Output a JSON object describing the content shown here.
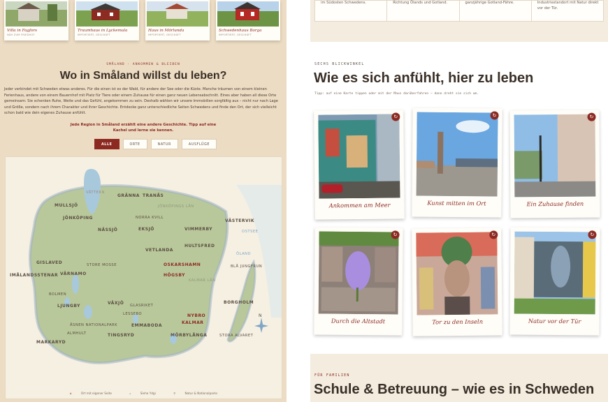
{
  "house_cards": [
    {
      "title": "Villa in Fagfors",
      "sub": "NÄH ZUM FRIEDHOF"
    },
    {
      "title": "Traumhaus in Lyckemala",
      "sub": "IMPORTIERT, GESCHÄFT"
    },
    {
      "title": "Haus in Mörlunda",
      "sub": "IMPORTIERT, GESCHÄFT"
    },
    {
      "title": "Schwedenhaus Borga",
      "sub": "IMPORTIERT, GESCHÄFT"
    }
  ],
  "region": {
    "kicker": "SMÅLAND · ANKOMMEN & BLEIBEN",
    "title": "Wo in Småland willst du leben?",
    "intro": "Jeder verbindet mit Schweden etwas anderes. Für die einen ist es der Wald, für andere der See oder die Küste. Manche träumen von einem kleinen Ferienhaus, andere von einem Bauernhof mit Platz für Tiere oder einem Zuhause für einen ganz neuen Lebensabschnitt. Eines aber haben all diese Orte gemeinsam: Sie schenken Ruhe, Weite und das Gefühl, angekommen zu sein. Deshalb wählen wir unsere Immobilien sorgfältig aus – nicht nur nach Lage und Größe, sondern nach ihrem Charakter und ihrer Geschichte. Entdecke ganz unterschiedliche Seiten Schwedens und finde den Ort, der sich vielleicht schon bald wie dein eigenes Zuhause anfühlt.",
    "hint": "Jede Region in Småland erzählt eine andere Geschichte. Tipp auf eine Kachel und lerne sie kennen."
  },
  "filters": [
    {
      "label": "ALLE",
      "active": true
    },
    {
      "label": "ORTE",
      "active": false
    },
    {
      "label": "NATUR",
      "active": false
    },
    {
      "label": "AUSFLÜGE",
      "active": false
    }
  ],
  "map": {
    "labels": [
      "VÄTTERN",
      "GRÄNNA",
      "TRANÅS",
      "MULLSJÖ",
      "JÖNKÖPINGS LÄN",
      "JÖNKÖPING",
      "NORRA KVILL",
      "VÄSTERVIK",
      "NÄSSJÖ",
      "EKSJÖ",
      "VIMMERBY",
      "OSTSEE",
      "HULTSFRED",
      "VETLANDA",
      "ÖLAND",
      "GISLAVED",
      "STORE MOSSE",
      "OSKARSHAMN",
      "BLÅ JUNGFRUN",
      "IMÅLANDSSTENAR",
      "VÄRNAMO",
      "HÖGSBY",
      "KALMAR LÄN",
      "BOLMEN",
      "LJUNGBY",
      "VÄXJÖ",
      "GLASRIKET",
      "BORGHOLM",
      "LESSEBO",
      "NYBRO",
      "KALMAR",
      "ÅSNEN NATIONALPARK",
      "EMMABODA",
      "ALMHULT",
      "TINGSRYD",
      "MÖRBYLÅNGA",
      "STORA ALVARET",
      "MARKARYD"
    ],
    "compass": "N",
    "legend": [
      "Ort mit eigener Seite",
      "Siehe Ydgi",
      "Natur & Nationalparks"
    ]
  },
  "info_cells": [
    "im Südosten Schwedens.",
    "Richtung Ölands und Gotland.",
    "ganzjährige Gotland-Fähre.",
    "Industriestandort mit Natur direkt vor der Tür."
  ],
  "section": {
    "kicker": "SECHS BLICKWINKEL",
    "title": "Wie es sich anfühlt, hier zu leben",
    "tip": "Tipp: auf eine Karte tippen oder mit der Maus darüberfahren – dann dreht sie sich um."
  },
  "polaroids": [
    {
      "label": "Ankommen am Meer"
    },
    {
      "label": "Kunst mitten im Ort"
    },
    {
      "label": "Ein Zuhause finden"
    },
    {
      "label": "Durch die Altstadt"
    },
    {
      "label": "Tor zu den Inseln"
    },
    {
      "label": "Natur vor der Tür"
    }
  ],
  "flip_icon": "↻",
  "next_section": {
    "kicker": "FÜR FAMILIEN",
    "title": "Schule & Betreuung – wie es in Schweden"
  },
  "colors": {
    "accent": "#8c2a22",
    "sand": "#ecdcc3",
    "land": "#b7c79a",
    "water": "#a8c8dc"
  }
}
